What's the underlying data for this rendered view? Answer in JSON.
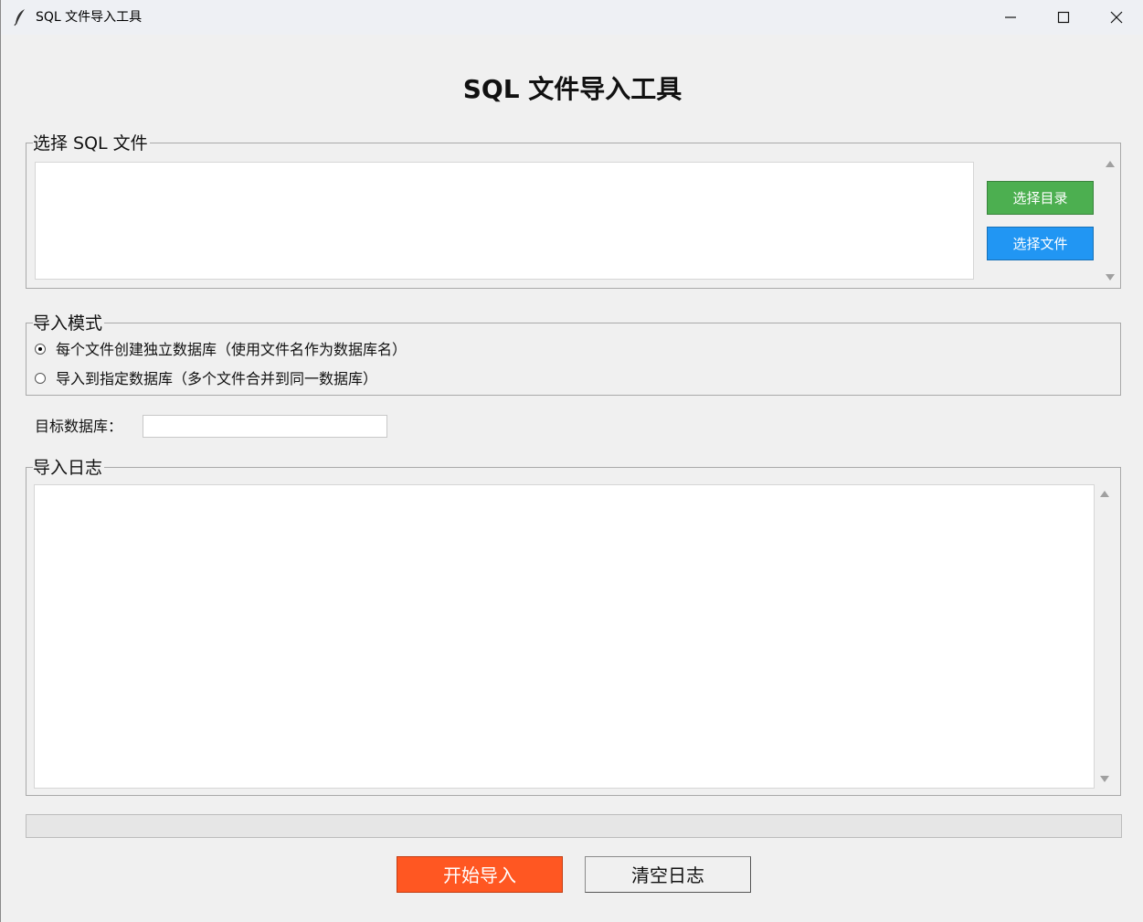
{
  "window": {
    "title": "SQL 文件导入工具",
    "icon": "feather-icon"
  },
  "header": {
    "title": "SQL 文件导入工具"
  },
  "file_select": {
    "legend": "选择 SQL 文件",
    "select_dir_label": "选择目录",
    "select_file_label": "选择文件",
    "select_dir_color": "#4caf50",
    "select_file_color": "#2196f3"
  },
  "import_mode": {
    "legend": "导入模式",
    "options": [
      {
        "label": "每个文件创建独立数据库（使用文件名作为数据库名）",
        "selected": true
      },
      {
        "label": "导入到指定数据库（多个文件合并到同一数据库）",
        "selected": false
      }
    ]
  },
  "target_db": {
    "label": "目标数据库：",
    "value": ""
  },
  "log": {
    "legend": "导入日志"
  },
  "progress": {
    "value": 0
  },
  "actions": {
    "start_label": "开始导入",
    "clear_label": "清空日志",
    "start_color": "#ff5722"
  }
}
